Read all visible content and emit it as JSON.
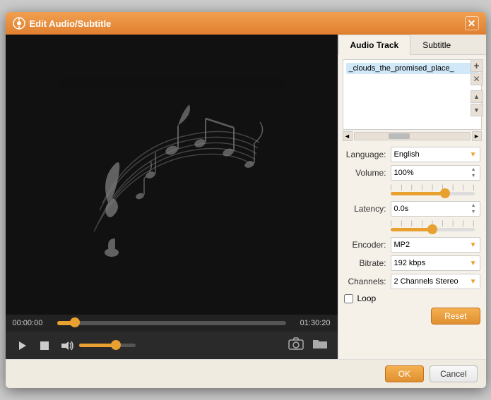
{
  "dialog": {
    "title": "Edit Audio/Subtitle",
    "close_label": "✕"
  },
  "tabs": {
    "audio_track": "Audio Track",
    "subtitle": "Subtitle",
    "active": "audio_track"
  },
  "track_list": {
    "item": "_clouds_the_promised_place_"
  },
  "buttons": {
    "add": "+",
    "remove": "✕",
    "up": "▲",
    "down": "▼",
    "left_arrow": "◄",
    "right_arrow": "►"
  },
  "language": {
    "label": "Language:",
    "value": "English"
  },
  "volume": {
    "label": "Volume:",
    "value": "100%",
    "slider_pct": 65
  },
  "latency": {
    "label": "Latency:",
    "value": "0.0s",
    "slider_pct": 50
  },
  "encoder": {
    "label": "Encoder:",
    "value": "MP2"
  },
  "bitrate": {
    "label": "Bitrate:",
    "value": "192 kbps"
  },
  "channels": {
    "label": "Channels:",
    "value": "2 Channels Stereo"
  },
  "loop": {
    "label": "Loop"
  },
  "footer": {
    "reset": "Reset",
    "ok": "OK",
    "cancel": "Cancel"
  },
  "player": {
    "time_current": "00:00:00",
    "time_total": "01:30:20",
    "progress_pct": 8,
    "volume_pct": 65
  }
}
